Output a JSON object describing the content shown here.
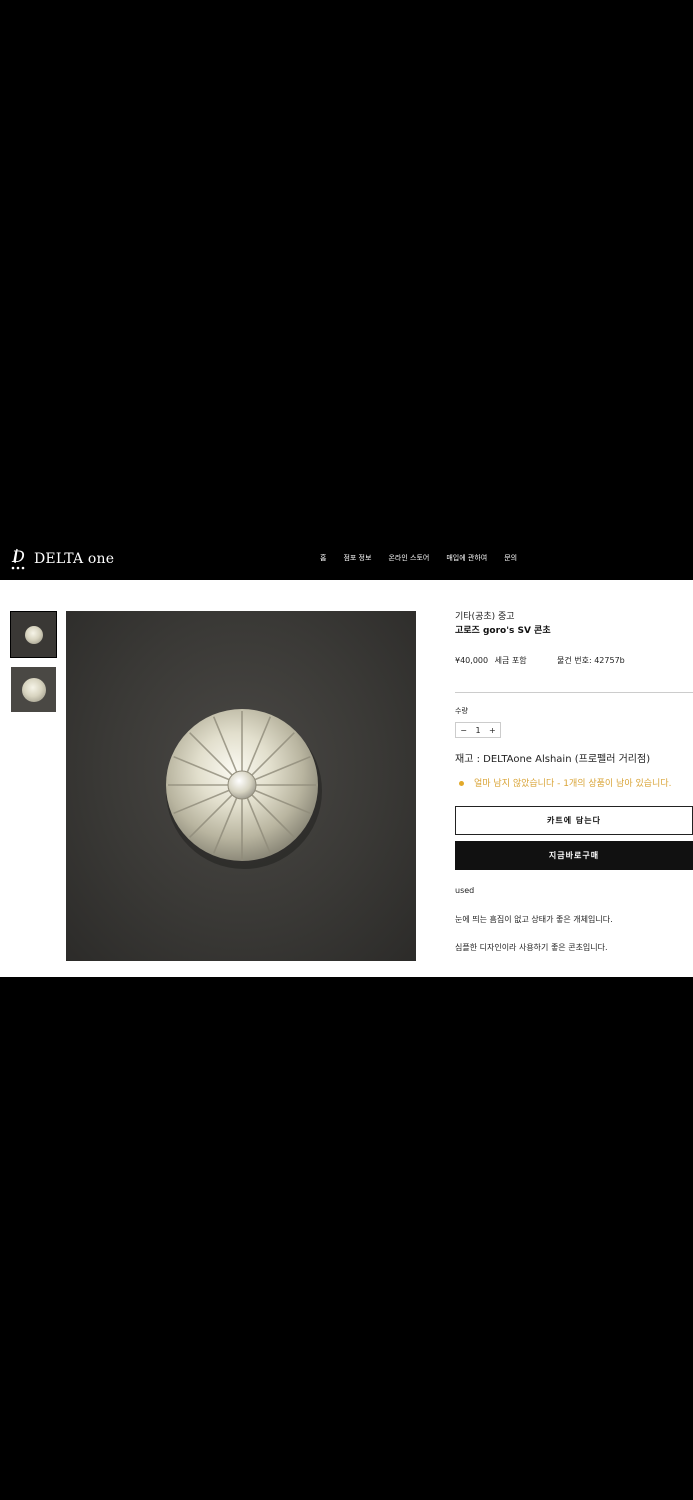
{
  "brand": {
    "name": "DELTA one"
  },
  "nav": [
    {
      "label": "홈"
    },
    {
      "label": "점포 정보"
    },
    {
      "label": "온라인 스토어"
    },
    {
      "label": "매입에 관하여"
    },
    {
      "label": "문의"
    }
  ],
  "product": {
    "category": "기타(공초) 중고",
    "title": "고로즈 goro's SV 콘초",
    "price": "¥40,000",
    "tax_note": "세금 포함",
    "sku": "물건 번호: 42757b",
    "quantity_label": "수량",
    "quantity": "1",
    "qty_minus": "−",
    "qty_plus": "+",
    "stock": "재고 : DELTAone Alshain (프로펠러 거리점)",
    "low_stock": "얼마 남지 않았습니다 - 1개의 상품이 남아 있습니다.",
    "add_to_cart": "카트에 담는다",
    "buy_now": "지금바로구매",
    "description": [
      "used",
      "눈에 띄는 흠집이 없고 상태가 좋은 개체입니다.",
      "심플한 디자인이라 사용하기 좋은 콘초입니다."
    ]
  },
  "colors": {
    "background": "#000000",
    "panel": "#ffffff",
    "accent_warning": "#e2a92a",
    "button_dark": "#111111"
  }
}
